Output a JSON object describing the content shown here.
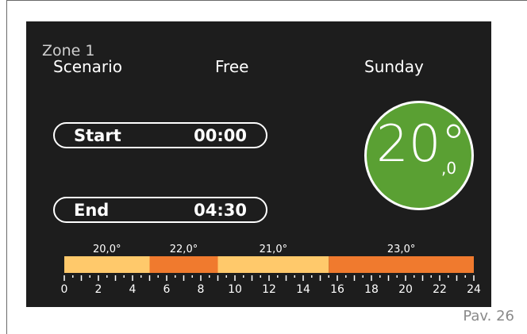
{
  "zone": {
    "title": "Zone 1"
  },
  "header": {
    "scenario_label": "Scenario",
    "mode": "Free",
    "day": "Sunday"
  },
  "start": {
    "label": "Start",
    "time": "00:00"
  },
  "end": {
    "label": "End",
    "time": "04:30"
  },
  "temperature": {
    "integer": "20°",
    "decimal": ",0",
    "circle_color": "#5aa033"
  },
  "timeline": {
    "segments": [
      {
        "from": 0,
        "to": 5,
        "temp": "20,0°",
        "color": "#ffc96b"
      },
      {
        "from": 5,
        "to": 9,
        "temp": "22,0°",
        "color": "#f07a2e"
      },
      {
        "from": 9,
        "to": 15.5,
        "temp": "21,0°",
        "color": "#ffc96b"
      },
      {
        "from": 15.5,
        "to": 24,
        "temp": "23,0°",
        "color": "#f07a2e"
      }
    ],
    "hour_labels": [
      "0",
      "2",
      "4",
      "6",
      "8",
      "10",
      "12",
      "14",
      "16",
      "18",
      "20",
      "22",
      "24"
    ]
  },
  "footer": {
    "page": "Pav. 26"
  }
}
